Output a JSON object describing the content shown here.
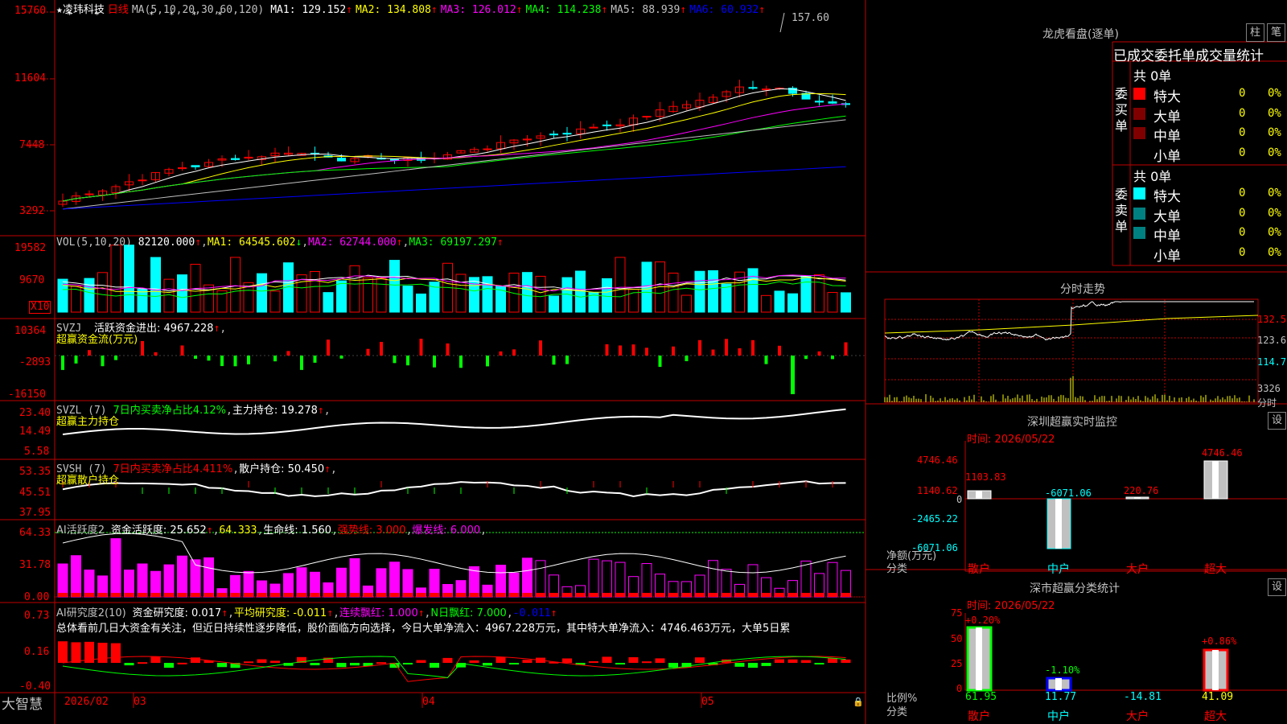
{
  "stock": {
    "name": "凌玮科技",
    "period": "日线",
    "ma_params": "MA(5,10,20,30,60,120)",
    "ma1": "MA1: 129.152",
    "ma2": "MA2: 134.808",
    "ma3": "MA3: 126.012",
    "ma4": "MA4: 114.238",
    "ma5": "MA5: 88.939",
    "ma6": "MA6: 60.932",
    "high_mark": "157.60",
    "price_ticks": [
      "15760",
      "11604",
      "7448",
      "3292"
    ]
  },
  "vol": {
    "params": "VOL(5,10,20)",
    "value": "82120.000",
    "ma1": "MA1: 64545.602",
    "ma2": "MA2: 62744.000",
    "ma3": "MA3: 69197.297",
    "ticks": [
      "19582",
      "9670"
    ],
    "unit": "X10"
  },
  "svzj": {
    "name": "SVZJ",
    "line1": "活跃资金进出: 4967.228",
    "line2": "超赢资金流(万元)",
    "ticks": [
      "10364",
      "-2893",
      "-16150"
    ]
  },
  "svzl": {
    "name": "SVZL (7)",
    "ratio": "7日内买卖净占比4.12%",
    "holding": "主力持仓: 19.278",
    "line2": "超赢主力持仓",
    "ticks": [
      "23.40",
      "14.49",
      "5.58"
    ]
  },
  "svsh": {
    "name": "SVSH (7)",
    "ratio": "7日内买卖净占比4.411%",
    "holding": "散户持仓: 50.450",
    "line2": "超赢散户持仓",
    "ticks": [
      "53.35",
      "45.51",
      "37.95"
    ]
  },
  "ai2": {
    "name": "AI活跃度2",
    "degree": "资金活跃度: 25.652",
    "v2": "64.333",
    "life": "生命线: 1.560",
    "strong": "强势线: 3.000",
    "burst": "爆发线: 6.000",
    "ticks": [
      "64.33",
      "31.78",
      "0.00"
    ]
  },
  "ai_research": {
    "name": "AI研究度2(10)",
    "degree": "资金研究度: 0.017",
    "avg": "平均研究度: -0.011",
    "lianxu": "连续飘红: 1.000",
    "nday": "N日飘红: 7.000",
    "v5": "-0.011",
    "comment": "总体看前几日大资金有关注，但近日持续性逐步降低，股价面临方向选择，今日大单净流入：4967.228万元，其中特大单净流入：4746.463万元，大单5日累",
    "ticks": [
      "0.73",
      "0.16",
      "-0.40"
    ]
  },
  "xaxis": {
    "brand": "大智慧",
    "dates": [
      "2026/02",
      "03",
      "04",
      "05"
    ]
  },
  "right": {
    "lhb_title": "龙虎看盘(逐单)",
    "tab_zhu": "柱",
    "tab_bi": "笔",
    "stats_header": "已成交委托单成交量统计",
    "buy_label": "委买单",
    "sell_label": "委卖单",
    "buy_total": "共 0单",
    "sell_total": "共 0单",
    "buy_rows": [
      {
        "name": "特大",
        "count": "0",
        "pct": "0%",
        "color": "#ff0000"
      },
      {
        "name": "大单",
        "count": "0",
        "pct": "0%",
        "color": "#800000"
      },
      {
        "name": "中单",
        "count": "0",
        "pct": "0%",
        "color": "#800000"
      },
      {
        "name": "小单",
        "count": "0",
        "pct": "0%",
        "color": ""
      }
    ],
    "sell_rows": [
      {
        "name": "特大",
        "count": "0",
        "pct": "0%",
        "color": "#00ffff"
      },
      {
        "name": "大单",
        "count": "0",
        "pct": "0%",
        "color": "#008080"
      },
      {
        "name": "中单",
        "count": "0",
        "pct": "0%",
        "color": "#008080"
      },
      {
        "name": "小单",
        "count": "0",
        "pct": "0%",
        "color": ""
      }
    ],
    "fenshi_title": "分时走势",
    "fenshi_ticks": [
      "132.5",
      "123.6",
      "114.7",
      "3326",
      "分时"
    ],
    "sz_title": "深圳超赢实时监控",
    "sz_setting": "设",
    "sz_time": "时间: 2026/05/22",
    "sz_ticks": [
      "4746.46",
      "1140.62",
      "0",
      "-2465.22",
      "-6071.06"
    ],
    "sz_bars": [
      {
        "cat": "散户",
        "value": 1103.83,
        "label": "1103.83"
      },
      {
        "cat": "中户",
        "value": -6071.06,
        "label": "-6071.06"
      },
      {
        "cat": "大户",
        "value": 220.76,
        "label": "220.76"
      },
      {
        "cat": "超大",
        "value": 4746.46,
        "label": "4746.46"
      }
    ],
    "sz_ylabel": "净额(万元)",
    "sz_xlabel": "分类",
    "cls_title": "深市超赢分类统计",
    "cls_setting": "设",
    "cls_time": "时间: 2026/05/22",
    "cls_ticks": [
      "75",
      "50",
      "25",
      "0"
    ],
    "cls_bars": [
      {
        "cat": "散户",
        "value": 61.95,
        "label": "61.95",
        "pct": "+0.20%"
      },
      {
        "cat": "中户",
        "value": 11.77,
        "label": "11.77",
        "pct": "-1.10%"
      },
      {
        "cat": "大户",
        "value": -14.81,
        "label": "-14.81",
        "pct": ""
      },
      {
        "cat": "超大",
        "value": 41.09,
        "label": "41.09",
        "pct": "+0.86%"
      }
    ],
    "cls_ylabel": "比例%",
    "cls_xlabel": "分类"
  },
  "colors": {
    "up": "#ff0000",
    "down": "#00ffff",
    "ma1": "#ffffff",
    "ma2": "#ffff00",
    "ma3": "#ff00ff",
    "ma4": "#00ff00",
    "ma5": "#c0c0c0",
    "ma6": "#0000ff"
  }
}
